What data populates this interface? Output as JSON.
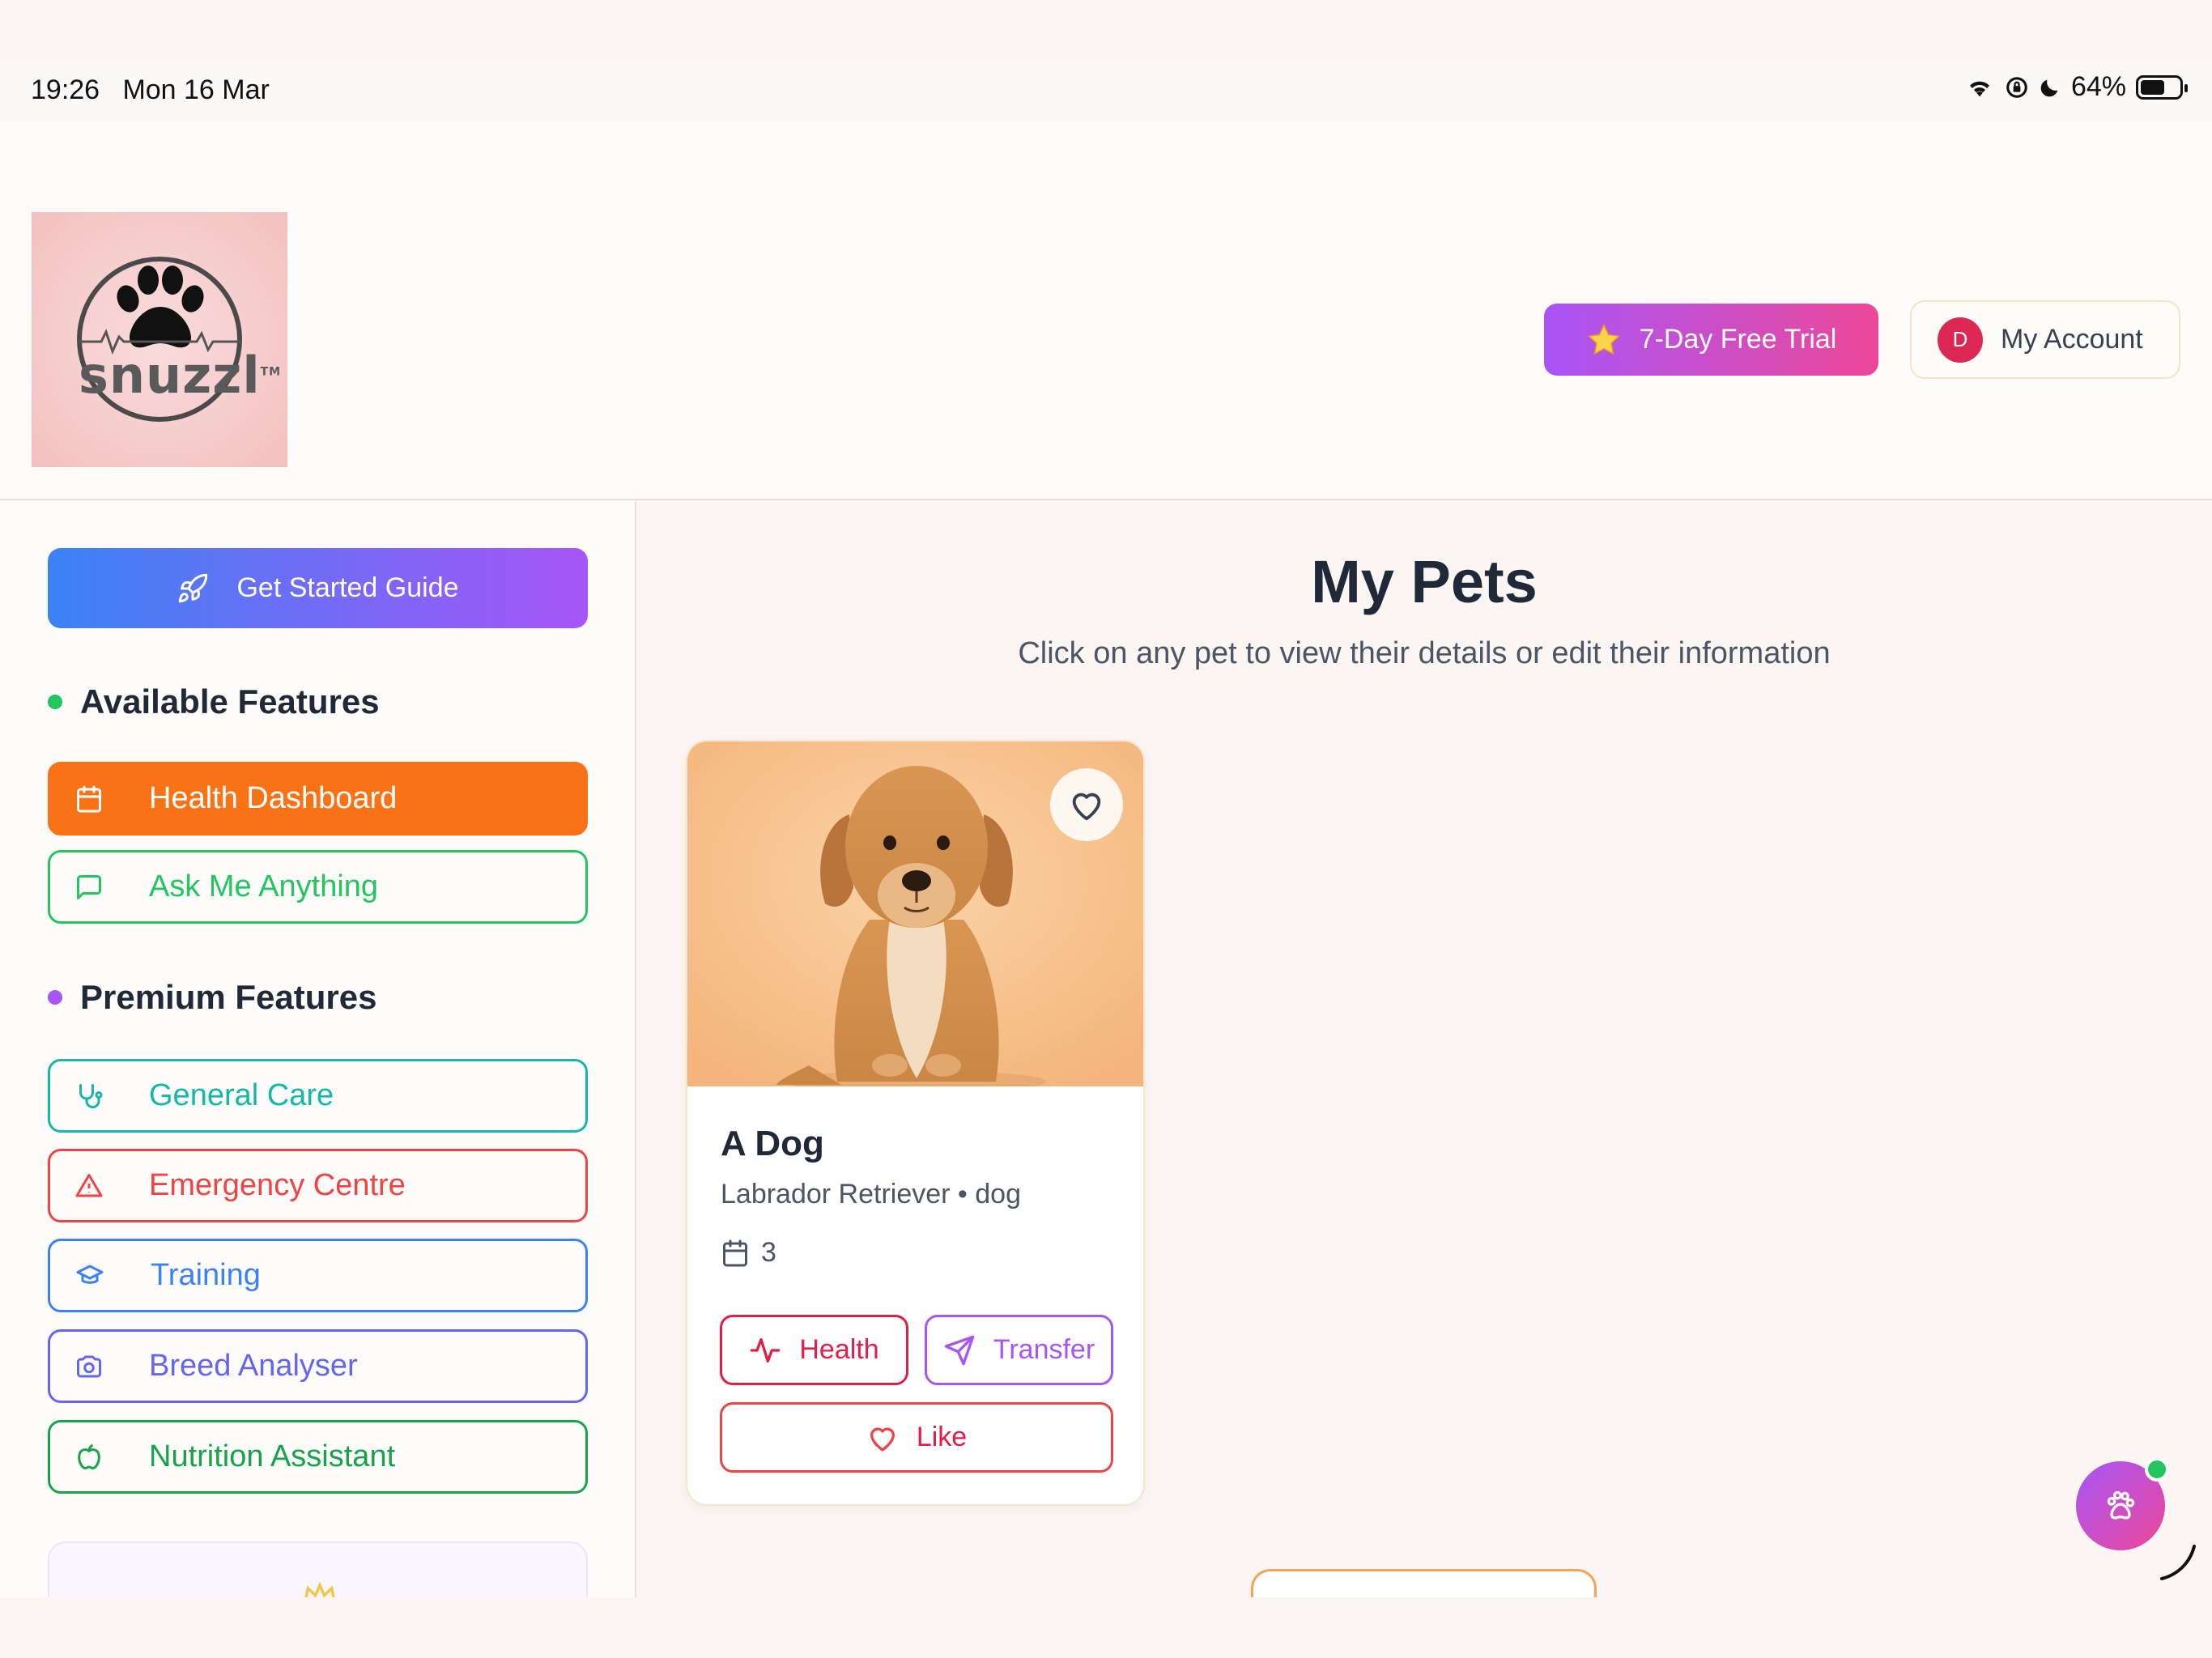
{
  "status_bar": {
    "time": "19:26",
    "date": "Mon 16 Mar",
    "battery": "64%",
    "battery_level": 0.64
  },
  "header": {
    "logo_text": "snuzzl",
    "logo_tm": "TM",
    "trial_label": "7-Day Free Trial",
    "account_label": "My Account",
    "account_initial": "D"
  },
  "sidebar": {
    "guide_label": "Get Started Guide",
    "available_title": "Available Features",
    "available_items": [
      {
        "label": "Health Dashboard",
        "icon": "calendar-icon",
        "color": "#f97316"
      },
      {
        "label": "Ask Me Anything",
        "icon": "message-icon",
        "color": "#22c55e"
      }
    ],
    "premium_title": "Premium Features",
    "premium_items": [
      {
        "label": "General Care",
        "icon": "stethoscope-icon",
        "color": "#14b8a6"
      },
      {
        "label": "Emergency Centre",
        "icon": "warning-icon",
        "color": "#ef4444"
      },
      {
        "label": "Training",
        "icon": "graduation-cap-icon",
        "color": "#3b82f6"
      },
      {
        "label": "Breed Analyser",
        "icon": "camera-icon",
        "color": "#6366f1"
      },
      {
        "label": "Nutrition Assistant",
        "icon": "apple-icon",
        "color": "#16a34a"
      }
    ]
  },
  "main": {
    "title": "My Pets",
    "subtitle": "Click on any pet to view their details or edit their information",
    "pet": {
      "name": "A Dog",
      "breed": "Labrador Retriever • dog",
      "age": "3",
      "health_label": "Health",
      "transfer_label": "Transfer",
      "like_label": "Like"
    }
  },
  "colors": {
    "accent_orange": "#f97316",
    "accent_purple": "#a855f7",
    "accent_pink": "#ec4899",
    "accent_blue": "#3b82f6"
  }
}
